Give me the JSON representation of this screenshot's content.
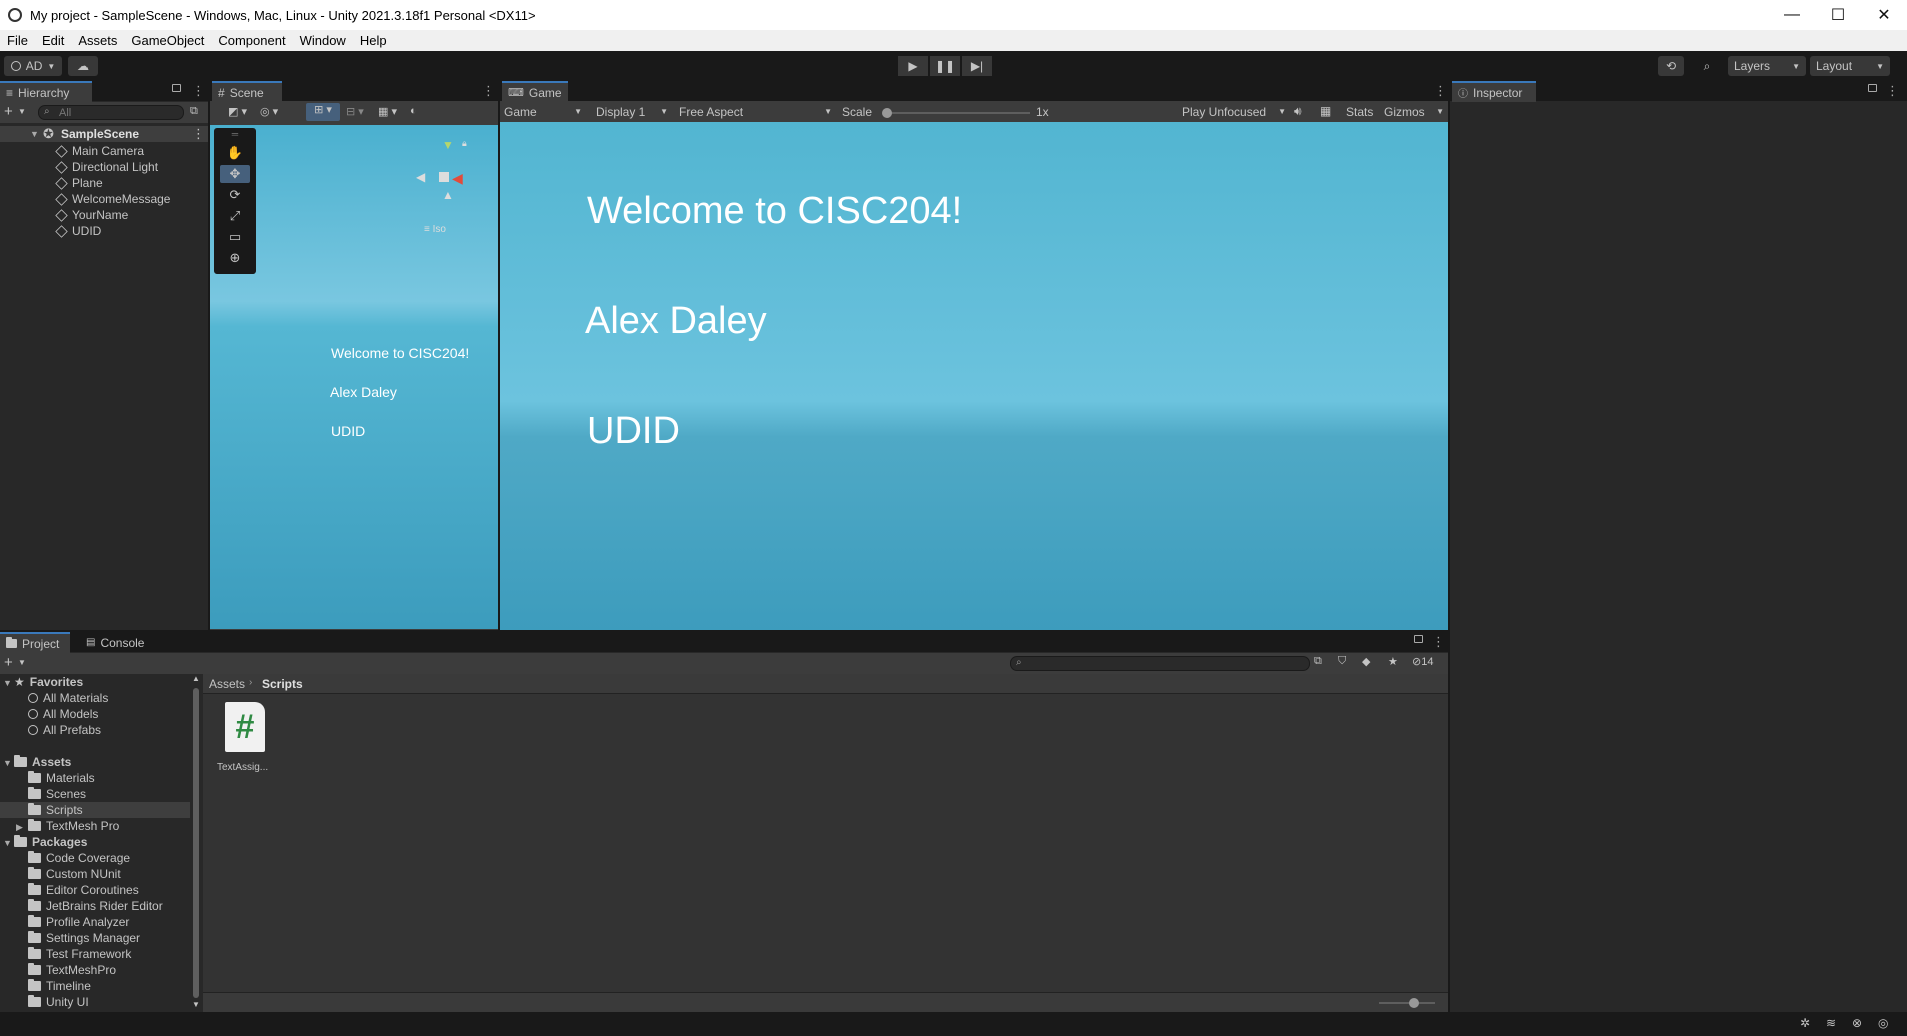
{
  "window": {
    "title": "My project - SampleScene - Windows, Mac, Linux - Unity 2021.3.18f1 Personal <DX11>",
    "minimize": "—",
    "maximize": "☐",
    "close": "✕"
  },
  "menu": [
    "File",
    "Edit",
    "Assets",
    "GameObject",
    "Component",
    "Window",
    "Help"
  ],
  "toolbar": {
    "account": "AD",
    "layers": "Layers",
    "layout": "Layout"
  },
  "hierarchy": {
    "tab": "Hierarchy",
    "search_placeholder": "All",
    "scene": "SampleScene",
    "items": [
      "Main Camera",
      "Directional Light",
      "Plane",
      "WelcomeMessage",
      "YourName",
      "UDID"
    ]
  },
  "scene": {
    "tab": "Scene",
    "gizmo_label": "Iso",
    "texts": [
      "Welcome to CISC204!",
      "Alex Daley",
      "UDID"
    ]
  },
  "game": {
    "tab": "Game",
    "mode": "Game",
    "display": "Display 1",
    "aspect": "Free Aspect",
    "scale_label": "Scale",
    "scale_value": "1x",
    "play_mode": "Play Unfocused",
    "stats": "Stats",
    "gizmos": "Gizmos",
    "texts": [
      "Welcome to CISC204!",
      "Alex Daley",
      "UDID"
    ]
  },
  "inspector": {
    "tab": "Inspector"
  },
  "project": {
    "tabs": [
      "Project",
      "Console"
    ],
    "hidden_count": "14",
    "breadcrumb": [
      "Assets",
      "Scripts"
    ],
    "favorites_label": "Favorites",
    "favorites": [
      "All Materials",
      "All Models",
      "All Prefabs"
    ],
    "assets_label": "Assets",
    "assets": [
      "Materials",
      "Scenes",
      "Scripts",
      "TextMesh Pro"
    ],
    "packages_label": "Packages",
    "packages": [
      "Code Coverage",
      "Custom NUnit",
      "Editor Coroutines",
      "JetBrains Rider Editor",
      "Profile Analyzer",
      "Settings Manager",
      "Test Framework",
      "TextMeshPro",
      "Timeline",
      "Unity UI"
    ],
    "files": [
      {
        "name": "TextAssig...",
        "icon": "#"
      }
    ]
  },
  "colors": {
    "accent": "#3a79bb",
    "selection": "#2c5d87",
    "panel": "#282828",
    "script_icon": "#2f8a43"
  }
}
